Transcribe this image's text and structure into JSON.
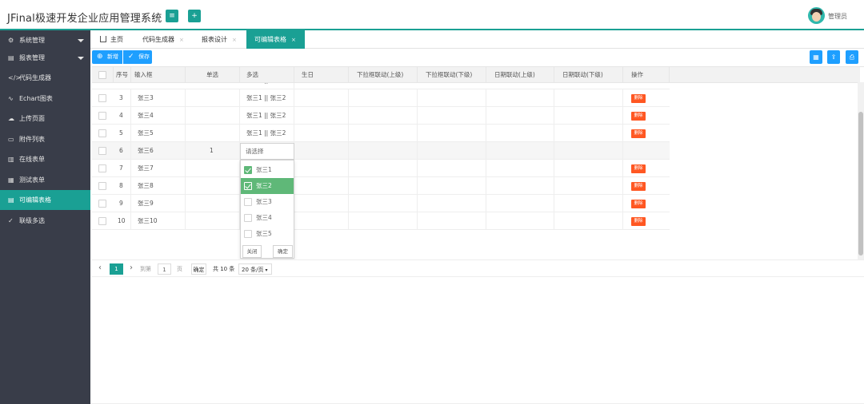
{
  "header": {
    "title": "JFinal极速开发企业应用管理系统",
    "btn_menu_icon": "≡",
    "btn_add_icon": "+",
    "admin": "管理员"
  },
  "sidebar": {
    "items": [
      {
        "label": "系统管理",
        "icon": "⚙",
        "icon_name": "gear-icon"
      },
      {
        "label": "报表管理",
        "icon": "▤",
        "icon_name": "report-icon"
      },
      {
        "label": "代码生成器",
        "icon": "</>",
        "icon_name": "code-icon"
      },
      {
        "label": "Echart图表",
        "icon": "∿",
        "icon_name": "chart-icon"
      },
      {
        "label": "上传页面",
        "icon": "☁",
        "icon_name": "cloud-icon"
      },
      {
        "label": "附件列表",
        "icon": "▭",
        "icon_name": "attachment-icon"
      },
      {
        "label": "在线表单",
        "icon": "▥",
        "icon_name": "form-icon"
      },
      {
        "label": "测试表单",
        "icon": "▦",
        "icon_name": "test-form-icon"
      },
      {
        "label": "可编辑表格",
        "icon": "▤",
        "icon_name": "table-icon"
      },
      {
        "label": "联级多选",
        "icon": "✓",
        "icon_name": "cascade-icon"
      }
    ]
  },
  "tabs": [
    {
      "label": "主页"
    },
    {
      "label": "代码生成器",
      "close": "×"
    },
    {
      "label": "报表设计",
      "close": "×"
    },
    {
      "label": "可编辑表格",
      "close": "×"
    }
  ],
  "toolbar": {
    "add_label": "新增",
    "save_label": "保存",
    "add_icon": "⊕",
    "save_icon": "✓",
    "right_icons": [
      "▦",
      "⇪",
      "⎙"
    ]
  },
  "table": {
    "columns": [
      "序号",
      "输入框",
      "单选",
      "多选",
      "生日",
      "下拉框联动(上级)",
      "下拉框联动(下级)",
      "日期联动(上级)",
      "日期联动(下级)",
      "操作"
    ],
    "partial_row": {
      "multi": "张三1 || 张三2"
    },
    "rows": [
      {
        "no": "3",
        "name": "张三3",
        "radio": "",
        "multi": "张三1 || 张三2"
      },
      {
        "no": "4",
        "name": "张三4",
        "radio": "",
        "multi": "张三1 || 张三2"
      },
      {
        "no": "5",
        "name": "张三5",
        "radio": "",
        "multi": "张三1 || 张三2"
      },
      {
        "no": "6",
        "name": "张三6",
        "radio": "1",
        "multi": ""
      },
      {
        "no": "7",
        "name": "张三7",
        "radio": "",
        "multi": ""
      },
      {
        "no": "8",
        "name": "张三8",
        "radio": "",
        "multi": ""
      },
      {
        "no": "9",
        "name": "张三9",
        "radio": "",
        "multi": ""
      },
      {
        "no": "10",
        "name": "张三10",
        "radio": "",
        "multi": ""
      }
    ],
    "delete_label": "删除"
  },
  "multiselect": {
    "placeholder": "请选择",
    "options": [
      {
        "label": "张三1",
        "checked": true,
        "highlight": false
      },
      {
        "label": "张三2",
        "checked": true,
        "highlight": true
      },
      {
        "label": "张三3",
        "checked": false,
        "highlight": false
      },
      {
        "label": "张三4",
        "checked": false,
        "highlight": false
      },
      {
        "label": "张三5",
        "checked": false,
        "highlight": false
      }
    ],
    "close_label": "关闭",
    "confirm_label": "确定"
  },
  "pager": {
    "prev": "‹",
    "current": "1",
    "next": "›",
    "goto_label": "到第",
    "goto_value": "1",
    "page_unit": "页",
    "confirm": "确定",
    "total": "共 10 条",
    "limit": "20 条/页"
  }
}
